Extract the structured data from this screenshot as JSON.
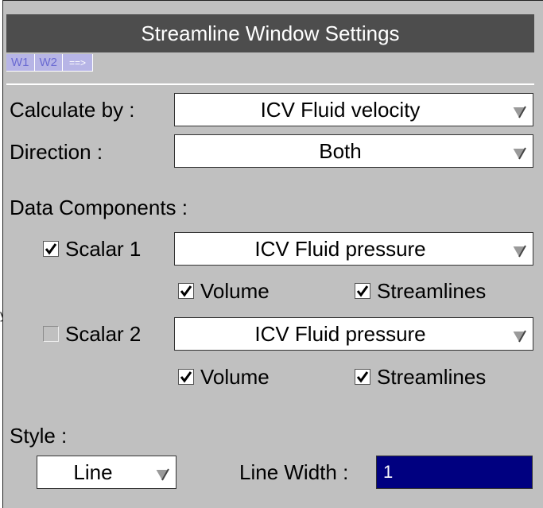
{
  "window": {
    "title": "Streamline Window Settings"
  },
  "tabs": [
    {
      "label": "W1"
    },
    {
      "label": "W2"
    },
    {
      "label": "==>"
    }
  ],
  "edge_text": "y",
  "calculate_by": {
    "label": "Calculate by :",
    "value": "ICV Fluid velocity"
  },
  "direction": {
    "label": "Direction :",
    "value": "Both"
  },
  "data_components": {
    "label": "Data Components :",
    "scalar1": {
      "label": "Scalar 1",
      "checked": true,
      "value": "ICV Fluid pressure",
      "volume": {
        "label": "Volume",
        "checked": true
      },
      "streamlines": {
        "label": "Streamlines",
        "checked": true
      }
    },
    "scalar2": {
      "label": "Scalar 2",
      "checked": false,
      "value": "ICV Fluid pressure",
      "volume": {
        "label": "Volume",
        "checked": true
      },
      "streamlines": {
        "label": "Streamlines",
        "checked": true
      }
    }
  },
  "style": {
    "label": "Style :",
    "type_value": "Line",
    "line_width": {
      "label": "Line Width :",
      "value": "1"
    }
  }
}
